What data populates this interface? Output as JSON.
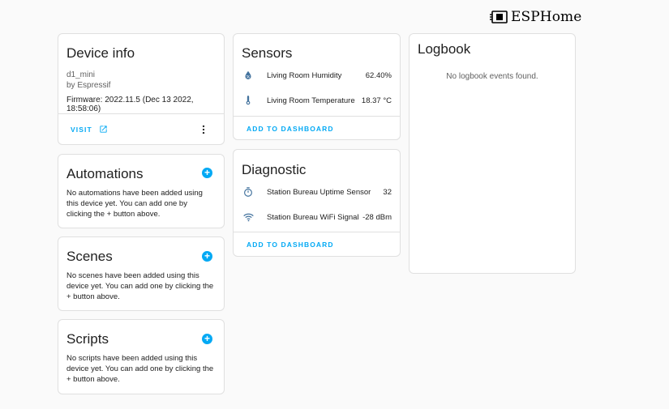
{
  "brand": {
    "name": "ESPHome"
  },
  "device_info": {
    "title": "Device info",
    "model": "d1_mini",
    "manufacturer": "by Espressif",
    "firmware": "Firmware: 2022.11.5 (Dec 13 2022, 18:58:06)",
    "visit_label": "VISIT"
  },
  "automations": {
    "title": "Automations",
    "text": "No automations have been added using this device yet. You can add one by clicking the + button above."
  },
  "scenes": {
    "title": "Scenes",
    "text": "No scenes have been added using this device yet. You can add one by clicking the + button above."
  },
  "scripts": {
    "title": "Scripts",
    "text": "No scripts have been added using this device yet. You can add one by clicking the + button above."
  },
  "sensors": {
    "title": "Sensors",
    "items": [
      {
        "label": "Living Room Humidity",
        "value": "62.40%",
        "icon": "water-percent-icon"
      },
      {
        "label": "Living Room Temperature",
        "value": "18.37 °C",
        "icon": "thermometer-icon"
      }
    ],
    "add_label": "ADD TO DASHBOARD"
  },
  "diagnostic": {
    "title": "Diagnostic",
    "items": [
      {
        "label": "Station Bureau Uptime Sensor",
        "value": "32",
        "icon": "timer-icon"
      },
      {
        "label": "Station Bureau WiFi Signal",
        "value": "-28 dBm",
        "icon": "wifi-icon"
      }
    ],
    "add_label": "ADD TO DASHBOARD"
  },
  "logbook": {
    "title": "Logbook",
    "empty_text": "No logbook events found."
  },
  "colors": {
    "accent": "#03a9f4",
    "icon": "#44739e"
  }
}
